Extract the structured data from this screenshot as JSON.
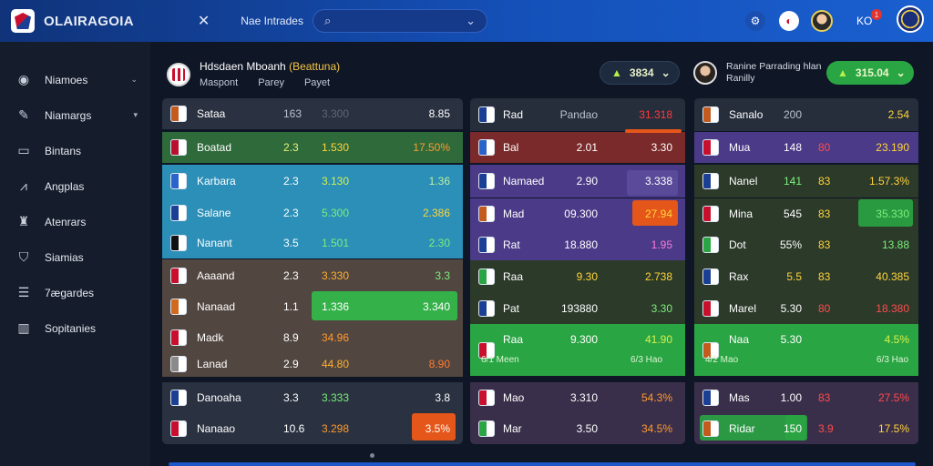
{
  "app": {
    "brand": "OLAIRAGOIA",
    "nav_title": "Nae Intrades",
    "search_placeholder": ""
  },
  "topbar": {
    "notif_label": "KO",
    "notif_count": "1"
  },
  "sidebar": {
    "items": [
      {
        "label": "Niamoes",
        "icon": "soccer-ball-icon",
        "chevron": "⌄"
      },
      {
        "label": "Niamargs",
        "icon": "pen-icon",
        "chevron": "▾"
      },
      {
        "label": "Bintans",
        "icon": "monitor-icon",
        "chevron": ""
      },
      {
        "label": "Angplas",
        "icon": "chart-icon",
        "chevron": ""
      },
      {
        "label": "Atenrars",
        "icon": "trophy-icon",
        "chevron": ""
      },
      {
        "label": "Siamias",
        "icon": "shield-icon",
        "chevron": ""
      },
      {
        "label": "7ægardes",
        "icon": "list-icon",
        "chevron": ""
      },
      {
        "label": "Sopitanies",
        "icon": "bar-chart-icon",
        "chevron": ""
      }
    ]
  },
  "header": {
    "title_main": "Hdsdaen Mboanh",
    "title_highlight": "(Beattuna)",
    "sub": [
      "Maspont",
      "Parey",
      "Payet"
    ],
    "pill_left": "3834",
    "pill_right": "315.04",
    "mid_text_line1": "Ranine Parrading hlan",
    "mid_text_line2": "Ranilly"
  },
  "col1": {
    "rows": [
      {
        "name": "Sataa",
        "a": "163",
        "b": "3.300",
        "c": "8.85",
        "bg": "#2a3140",
        "ca": "#b9c1d0",
        "cb": "#5f6776",
        "cc": "#ffffff",
        "crest": "#c35a1e"
      },
      {
        "name": "Boatad",
        "a": "2.3",
        "b": "1.530",
        "c": "17.50%",
        "bg": "#2f6a3a",
        "ca": "#e7f07a",
        "cb": "#ffd43b",
        "cc": "#ff9a2e",
        "crest": "#b8102e"
      },
      {
        "name": "Karbara",
        "a": "2.3",
        "b": "3.130",
        "c": "1.36",
        "bg": "#2b8fb8",
        "ca": "#ffffff",
        "cb": "#d7f04a",
        "cc": "#b9f0a0",
        "crest": "#2a63c9"
      },
      {
        "name": "Salane",
        "a": "2.3",
        "b": "5.300",
        "c": "2.386",
        "bg": "#2b8fb8",
        "ca": "#ffffff",
        "cb": "#7bf07a",
        "cc": "#ffd43b",
        "crest": "#1b3f94"
      },
      {
        "name": "Nanant",
        "a": "3.5",
        "b": "1.501",
        "c": "2.30",
        "bg": "#2b8fb8",
        "ca": "#ffffff",
        "cb": "#7bf07a",
        "cc": "#7bf07a",
        "crest": "#111111"
      },
      {
        "name": "Aaaand",
        "a": "2.3",
        "b": "3.330",
        "c": "3.3",
        "bg": "#524640",
        "ca": "#ffffff",
        "cb": "#ffb02e",
        "cc": "#7bf07a",
        "crest": "#c8102e"
      },
      {
        "name": "Nanaad",
        "a": "1.1",
        "b": "1.336",
        "c": "3.340",
        "bg": "#524640",
        "ca": "#ffffff",
        "cb": "#ffffff",
        "cc": "#ffffff",
        "crest": "#d06a1e"
      },
      {
        "name": "Madk",
        "a": "8.9",
        "b": "34.96",
        "c": "",
        "bg": "#524640",
        "ca": "#ffffff",
        "cb": "#ff9a2e",
        "cc": "#ffffff",
        "crest": "#c8102e"
      },
      {
        "name": "Lanad",
        "a": "2.9",
        "b": "44.80",
        "c": "8.90",
        "bg": "#524640",
        "ca": "#ffffff",
        "cb": "#ffb02e",
        "cc": "#ff7a2e",
        "crest": "#8a8a8a"
      },
      {
        "name": "Danoaha",
        "a": "3.3",
        "b": "3.333",
        "c": "3.8",
        "bg": "#2a3140",
        "ca": "#ffffff",
        "cb": "#7bf07a",
        "cc": "#ffffff",
        "crest": "#1b3f94"
      },
      {
        "name": "Nanaao",
        "a": "10.6",
        "b": "3.298",
        "c": "3.5%",
        "bg": "#2a3140",
        "ca": "#ffffff",
        "cb": "#ff9a2e",
        "cc": "#ffffff",
        "crest": "#c8102e"
      }
    ]
  },
  "col2": {
    "rows": [
      {
        "name": "Rad",
        "a": "Pandao",
        "b": "31.318",
        "bg": "#262d3b",
        "ca": "#b9c1d0",
        "cb": "#ff3b3b",
        "crest": "#1b3f94"
      },
      {
        "name": "Bal",
        "a": "2.01",
        "b": "3.30",
        "bg": "#7a2a2a",
        "ca": "#ffffff",
        "cb": "#ffffff",
        "crest": "#2a63c9"
      },
      {
        "name": "Namaed",
        "a": "2.90",
        "b": "3.338",
        "bg": "#4a3a88",
        "ca": "#ffffff",
        "cb": "#ffffff",
        "crest": "#1b3f94"
      },
      {
        "name": "Mad",
        "a": "09.300",
        "b": "27.94",
        "bg": "#4a3a88",
        "ca": "#ffffff",
        "cb": "#ffd43b",
        "crest": "#c35a1e"
      },
      {
        "name": "Rat",
        "a": "18.880",
        "b": "1.95",
        "bg": "#4a3a88",
        "ca": "#ffffff",
        "cb": "#ff7ad9",
        "crest": "#1b3f94"
      },
      {
        "name": "Raa",
        "a": "9.30",
        "b": "2.738",
        "bg": "#2c3a2a",
        "ca": "#ffd43b",
        "cb": "#ffd43b",
        "crest": "#2aa544"
      },
      {
        "name": "Pat",
        "a": "193880",
        "b": "3.30",
        "bg": "#2c3a2a",
        "ca": "#ffffff",
        "cb": "#7bf07a",
        "crest": "#1b3f94"
      },
      {
        "name": "Raa",
        "a": "9.300",
        "b": "41.90",
        "bg": "#2aa544",
        "ca": "#ffffff",
        "cb": "#d7f04a",
        "crest": "#c8102e"
      },
      {
        "name": "Mao",
        "a": "3.310",
        "b": "54.3%",
        "bg": "#3a2f4a",
        "ca": "#ffffff",
        "cb": "#ff9a2e",
        "crest": "#c8102e"
      },
      {
        "name": "Mar",
        "a": "3.50",
        "b": "34.5%",
        "bg": "#3a2f4a",
        "ca": "#ffffff",
        "cb": "#ff9a2e",
        "crest": "#2aa544"
      }
    ],
    "green_footer_left": "6/1 Meen",
    "green_footer_right": "6/3 Hao"
  },
  "col3": {
    "rows": [
      {
        "name": "Sanalo",
        "a": "200",
        "b": "",
        "c": "2.54",
        "bg": "#262d3b",
        "ca": "#b9c1d0",
        "cb": "#ff4b4b",
        "cc": "#ffd43b",
        "crest": "#c35a1e"
      },
      {
        "name": "Mua",
        "a": "148",
        "b": "80",
        "c": "23.190",
        "bg": "#4a3a88",
        "ca": "#ffffff",
        "cb": "#ff4b4b",
        "cc": "#ffd43b",
        "crest": "#c8102e"
      },
      {
        "name": "Nanel",
        "a": "141",
        "b": "83",
        "c": "1.57.3%",
        "bg": "#2c3a2a",
        "ca": "#7bf07a",
        "cb": "#ffd43b",
        "cc": "#ffd43b",
        "crest": "#1b3f94"
      },
      {
        "name": "Mina",
        "a": "545",
        "b": "83",
        "c": "35.330",
        "bg": "#2c3a2a",
        "ca": "#ffffff",
        "cb": "#ffd43b",
        "cc": "#7bf07a",
        "crest": "#c8102e"
      },
      {
        "name": "Dot",
        "a": "55%",
        "b": "83",
        "c": "13.88",
        "bg": "#2c3a2a",
        "ca": "#ffffff",
        "cb": "#ffd43b",
        "cc": "#7bf07a",
        "crest": "#2aa544"
      },
      {
        "name": "Rax",
        "a": "5.5",
        "b": "83",
        "c": "40.385",
        "bg": "#2c3a2a",
        "ca": "#ffd43b",
        "cb": "#ffd43b",
        "cc": "#ffd43b",
        "crest": "#1b3f94"
      },
      {
        "name": "Marel",
        "a": "5.30",
        "b": "80",
        "c": "18.380",
        "bg": "#2c3a2a",
        "ca": "#ffffff",
        "cb": "#ff4b4b",
        "cc": "#ff4b4b",
        "crest": "#c8102e"
      },
      {
        "name": "Naa",
        "a": "5.30",
        "b": "",
        "c": "4.5%",
        "bg": "#2aa544",
        "ca": "#ffffff",
        "cb": "#ffffff",
        "cc": "#d7f04a",
        "crest": "#c35a1e"
      },
      {
        "name": "Mas",
        "a": "1.00",
        "b": "83",
        "c": "27.5%",
        "bg": "#3a2f4a",
        "ca": "#ffffff",
        "cb": "#ff4b4b",
        "cc": "#ff4b4b",
        "crest": "#1b3f94"
      },
      {
        "name": "Ridar",
        "a": "150",
        "b": "3.9",
        "c": "17.5%",
        "bg": "#3a2f4a",
        "ca": "#ffffff",
        "cb": "#ff4b4b",
        "cc": "#ffd43b",
        "crest": "#c35a1e"
      }
    ],
    "green_footer_left": "4/2 Mao",
    "green_footer_right": "6/3 Hao"
  }
}
